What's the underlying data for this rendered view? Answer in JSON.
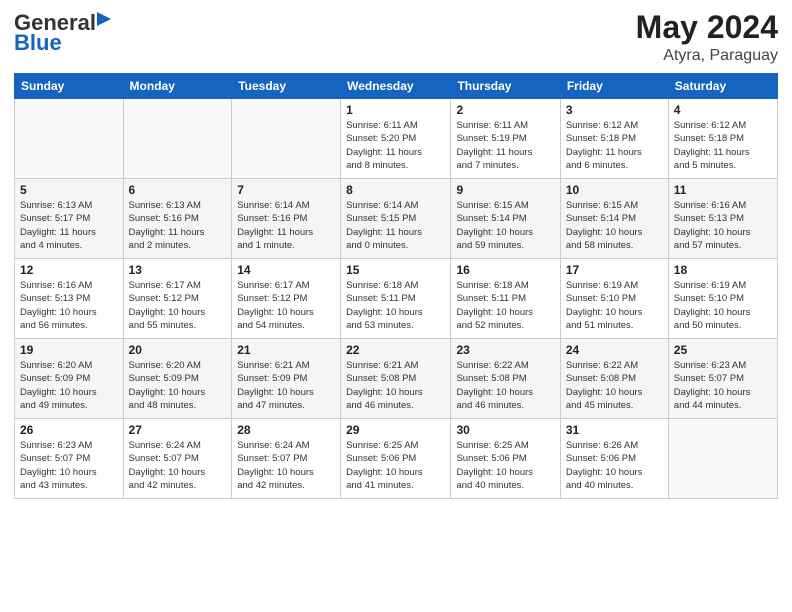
{
  "header": {
    "logo_general": "General",
    "logo_blue": "Blue",
    "month_year": "May 2024",
    "location": "Atyra, Paraguay"
  },
  "days_of_week": [
    "Sunday",
    "Monday",
    "Tuesday",
    "Wednesday",
    "Thursday",
    "Friday",
    "Saturday"
  ],
  "weeks": [
    [
      {
        "day": "",
        "info": ""
      },
      {
        "day": "",
        "info": ""
      },
      {
        "day": "",
        "info": ""
      },
      {
        "day": "1",
        "info": "Sunrise: 6:11 AM\nSunset: 5:20 PM\nDaylight: 11 hours\nand 8 minutes."
      },
      {
        "day": "2",
        "info": "Sunrise: 6:11 AM\nSunset: 5:19 PM\nDaylight: 11 hours\nand 7 minutes."
      },
      {
        "day": "3",
        "info": "Sunrise: 6:12 AM\nSunset: 5:18 PM\nDaylight: 11 hours\nand 6 minutes."
      },
      {
        "day": "4",
        "info": "Sunrise: 6:12 AM\nSunset: 5:18 PM\nDaylight: 11 hours\nand 5 minutes."
      }
    ],
    [
      {
        "day": "5",
        "info": "Sunrise: 6:13 AM\nSunset: 5:17 PM\nDaylight: 11 hours\nand 4 minutes."
      },
      {
        "day": "6",
        "info": "Sunrise: 6:13 AM\nSunset: 5:16 PM\nDaylight: 11 hours\nand 2 minutes."
      },
      {
        "day": "7",
        "info": "Sunrise: 6:14 AM\nSunset: 5:16 PM\nDaylight: 11 hours\nand 1 minute."
      },
      {
        "day": "8",
        "info": "Sunrise: 6:14 AM\nSunset: 5:15 PM\nDaylight: 11 hours\nand 0 minutes."
      },
      {
        "day": "9",
        "info": "Sunrise: 6:15 AM\nSunset: 5:14 PM\nDaylight: 10 hours\nand 59 minutes."
      },
      {
        "day": "10",
        "info": "Sunrise: 6:15 AM\nSunset: 5:14 PM\nDaylight: 10 hours\nand 58 minutes."
      },
      {
        "day": "11",
        "info": "Sunrise: 6:16 AM\nSunset: 5:13 PM\nDaylight: 10 hours\nand 57 minutes."
      }
    ],
    [
      {
        "day": "12",
        "info": "Sunrise: 6:16 AM\nSunset: 5:13 PM\nDaylight: 10 hours\nand 56 minutes."
      },
      {
        "day": "13",
        "info": "Sunrise: 6:17 AM\nSunset: 5:12 PM\nDaylight: 10 hours\nand 55 minutes."
      },
      {
        "day": "14",
        "info": "Sunrise: 6:17 AM\nSunset: 5:12 PM\nDaylight: 10 hours\nand 54 minutes."
      },
      {
        "day": "15",
        "info": "Sunrise: 6:18 AM\nSunset: 5:11 PM\nDaylight: 10 hours\nand 53 minutes."
      },
      {
        "day": "16",
        "info": "Sunrise: 6:18 AM\nSunset: 5:11 PM\nDaylight: 10 hours\nand 52 minutes."
      },
      {
        "day": "17",
        "info": "Sunrise: 6:19 AM\nSunset: 5:10 PM\nDaylight: 10 hours\nand 51 minutes."
      },
      {
        "day": "18",
        "info": "Sunrise: 6:19 AM\nSunset: 5:10 PM\nDaylight: 10 hours\nand 50 minutes."
      }
    ],
    [
      {
        "day": "19",
        "info": "Sunrise: 6:20 AM\nSunset: 5:09 PM\nDaylight: 10 hours\nand 49 minutes."
      },
      {
        "day": "20",
        "info": "Sunrise: 6:20 AM\nSunset: 5:09 PM\nDaylight: 10 hours\nand 48 minutes."
      },
      {
        "day": "21",
        "info": "Sunrise: 6:21 AM\nSunset: 5:09 PM\nDaylight: 10 hours\nand 47 minutes."
      },
      {
        "day": "22",
        "info": "Sunrise: 6:21 AM\nSunset: 5:08 PM\nDaylight: 10 hours\nand 46 minutes."
      },
      {
        "day": "23",
        "info": "Sunrise: 6:22 AM\nSunset: 5:08 PM\nDaylight: 10 hours\nand 46 minutes."
      },
      {
        "day": "24",
        "info": "Sunrise: 6:22 AM\nSunset: 5:08 PM\nDaylight: 10 hours\nand 45 minutes."
      },
      {
        "day": "25",
        "info": "Sunrise: 6:23 AM\nSunset: 5:07 PM\nDaylight: 10 hours\nand 44 minutes."
      }
    ],
    [
      {
        "day": "26",
        "info": "Sunrise: 6:23 AM\nSunset: 5:07 PM\nDaylight: 10 hours\nand 43 minutes."
      },
      {
        "day": "27",
        "info": "Sunrise: 6:24 AM\nSunset: 5:07 PM\nDaylight: 10 hours\nand 42 minutes."
      },
      {
        "day": "28",
        "info": "Sunrise: 6:24 AM\nSunset: 5:07 PM\nDaylight: 10 hours\nand 42 minutes."
      },
      {
        "day": "29",
        "info": "Sunrise: 6:25 AM\nSunset: 5:06 PM\nDaylight: 10 hours\nand 41 minutes."
      },
      {
        "day": "30",
        "info": "Sunrise: 6:25 AM\nSunset: 5:06 PM\nDaylight: 10 hours\nand 40 minutes."
      },
      {
        "day": "31",
        "info": "Sunrise: 6:26 AM\nSunset: 5:06 PM\nDaylight: 10 hours\nand 40 minutes."
      },
      {
        "day": "",
        "info": ""
      }
    ]
  ]
}
